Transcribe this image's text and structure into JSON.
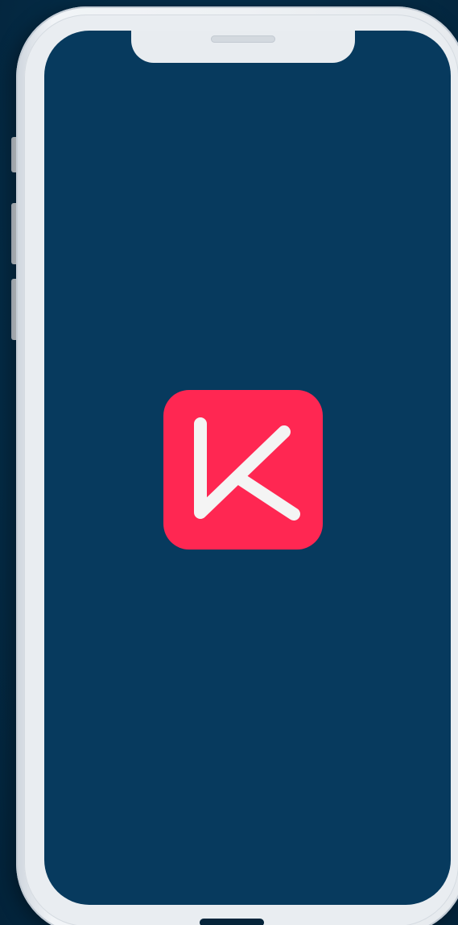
{
  "app": {
    "logo_letter": "K",
    "logo_icon": "k-letter-logo-icon"
  },
  "colors": {
    "background": "#052a44",
    "screen": "#073a5e",
    "device_frame": "#eef1f4",
    "logo_tile": "#ff2752",
    "logo_glyph": "#f4f4f4"
  }
}
